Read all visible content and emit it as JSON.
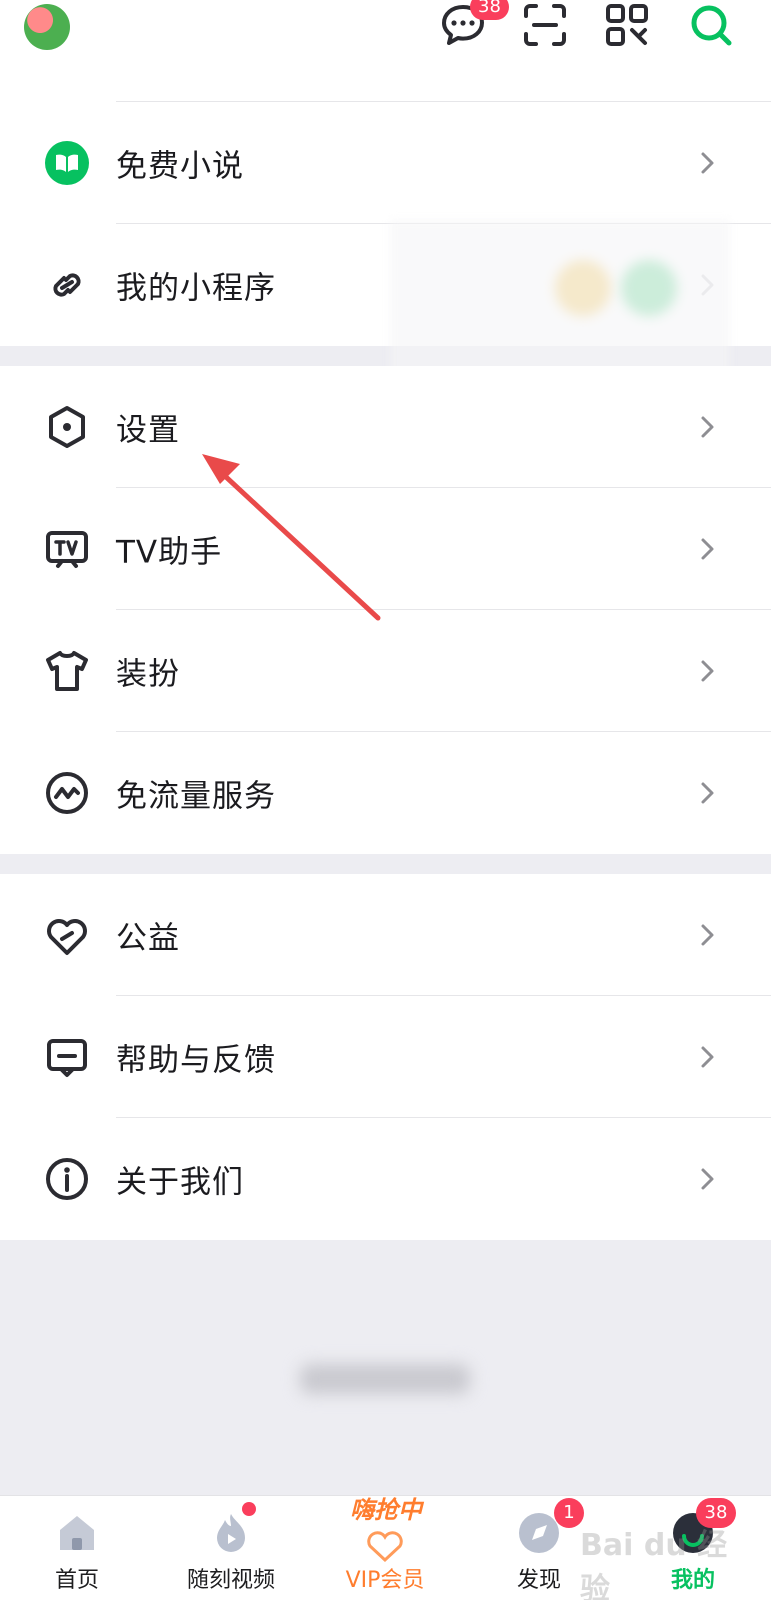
{
  "header": {
    "avatar_icon": "avatar-image",
    "message_badge": "38",
    "icons": [
      "message-icon",
      "scan-icon",
      "qr-code-icon",
      "search-icon"
    ],
    "accent": "#07c160"
  },
  "menu": {
    "sections": [
      {
        "items": [
          {
            "label": "免费小说",
            "icon": "book-icon"
          },
          {
            "label": "我的小程序",
            "icon": "mini-program-icon"
          }
        ]
      },
      {
        "items": [
          {
            "label": "设置",
            "icon": "settings-hex-icon"
          },
          {
            "label": "TV助手",
            "icon": "tv-icon"
          },
          {
            "label": "装扮",
            "icon": "shirt-icon"
          },
          {
            "label": "免流量服务",
            "icon": "wave-icon"
          }
        ]
      },
      {
        "items": [
          {
            "label": "公益",
            "icon": "heart-icon"
          },
          {
            "label": "帮助与反馈",
            "icon": "feedback-icon"
          },
          {
            "label": "关于我们",
            "icon": "info-icon"
          }
        ]
      }
    ]
  },
  "tabbar": {
    "tabs": [
      {
        "label": "首页",
        "icon": "home-icon"
      },
      {
        "label": "随刻视频",
        "icon": "video-flame-icon"
      },
      {
        "label": "VIP会员",
        "icon": "vip-heart-icon",
        "promo": "嗨抢中"
      },
      {
        "label": "发现",
        "icon": "compass-icon",
        "badge": "1"
      },
      {
        "label": "我的",
        "icon": "profile-icon",
        "badge": "38"
      }
    ]
  },
  "watermark": "Bai du 经验"
}
